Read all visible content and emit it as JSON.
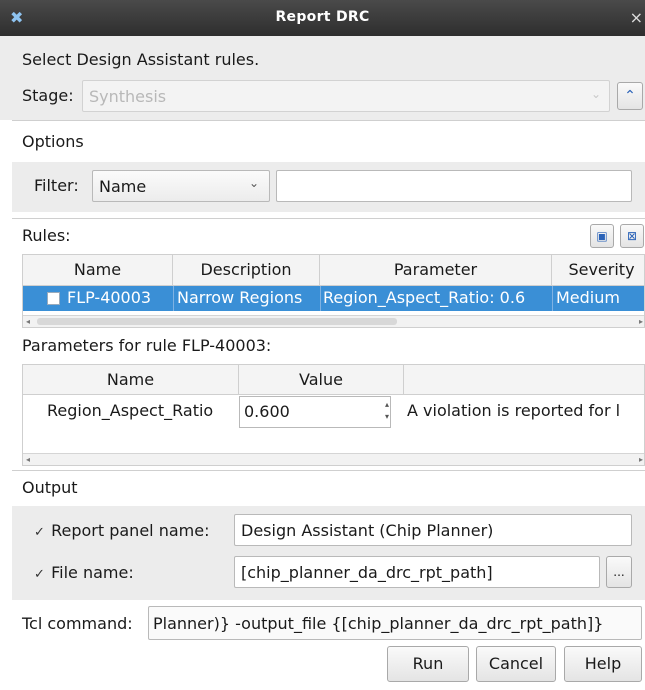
{
  "window": {
    "title": "Report DRC"
  },
  "header_text": "Select Design Assistant rules.",
  "stage": {
    "label": "Stage:",
    "value": "Synthesis"
  },
  "options": {
    "title": "Options",
    "filter_label": "Filter:",
    "filter_value": "Name",
    "filter_text": ""
  },
  "rules": {
    "title": "Rules:",
    "columns": [
      "Name",
      "Description",
      "Parameter",
      "Severity"
    ],
    "rows": [
      {
        "name": "FLP-40003",
        "description": "Narrow Regions",
        "parameter": "Region_Aspect_Ratio: 0.6",
        "severity": "Medium",
        "checked": false
      }
    ]
  },
  "parameters": {
    "title": "Parameters for rule FLP-40003:",
    "columns": [
      "Name",
      "Value"
    ],
    "rows": [
      {
        "name": "Region_Aspect_Ratio",
        "value": "0.600",
        "description": "A violation is reported for l"
      }
    ]
  },
  "output": {
    "title": "Output",
    "report_panel_label": "Report panel name:",
    "report_panel_value": "Design Assistant (Chip Planner)",
    "report_panel_checked": true,
    "file_label": "File name:",
    "file_value": "[chip_planner_da_drc_rpt_path]",
    "file_checked": true,
    "browse_label": "..."
  },
  "tcl": {
    "label": "Tcl command:",
    "value": "Planner)} -output_file {[chip_planner_da_drc_rpt_path]}"
  },
  "buttons": {
    "run": "Run",
    "cancel": "Cancel",
    "help": "Help"
  },
  "colors": {
    "selection": "#3a8fd6",
    "titlebar": "#3a3a3a",
    "panel": "#ececec"
  }
}
